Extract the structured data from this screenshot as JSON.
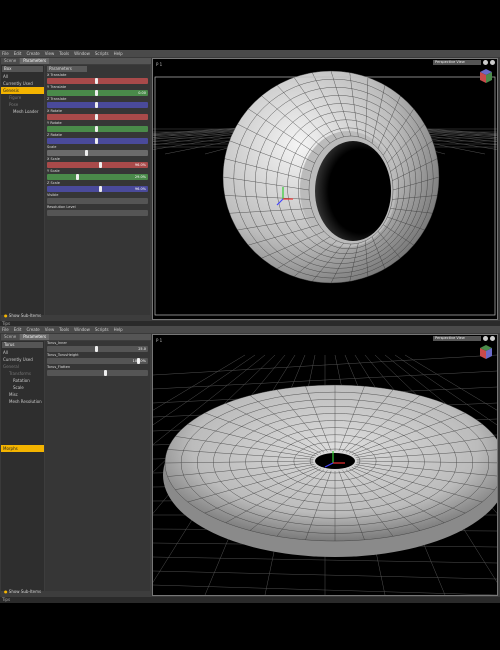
{
  "menu": [
    "File",
    "Edit",
    "Create",
    "View",
    "Tools",
    "Window",
    "Scripts",
    "Help"
  ],
  "screen1": {
    "tabs": [
      "Scene",
      "Parameters"
    ],
    "scene_dropdown": "Box",
    "tree": {
      "filters": [
        "All",
        "Currently Used"
      ],
      "items": [
        "Genesis",
        "Figure",
        "Pose",
        "Mesh Loader"
      ]
    },
    "params_dropdown": "Parameters",
    "params": [
      {
        "label": "X Translate",
        "value": "",
        "color": "#a84a4a",
        "knob": 0.5
      },
      {
        "label": "Y Translate",
        "value": "0.00",
        "color": "#4a8a4a",
        "knob": 0.5
      },
      {
        "label": "Z Translate",
        "value": "",
        "color": "#4a4a9a",
        "knob": 0.5
      },
      {
        "label": "X Rotate",
        "value": "",
        "color": "#a84a4a",
        "knob": 0.5
      },
      {
        "label": "Y Rotate",
        "value": "",
        "color": "#4a8a4a",
        "knob": 0.5
      },
      {
        "label": "Z Rotate",
        "value": "",
        "color": "#4a4a9a",
        "knob": 0.5
      },
      {
        "label": "Scale",
        "value": "",
        "color": "#6a6a6a",
        "knob": 0.4
      },
      {
        "label": "X Scale",
        "value": "96.0%",
        "color": "#a84a4a",
        "knob": 0.55
      },
      {
        "label": "Y Scale",
        "value": "29.0%",
        "color": "#4a8a4a",
        "knob": 0.3
      },
      {
        "label": "Z Scale",
        "value": "96.0%",
        "color": "#4a4a9a",
        "knob": 0.55
      },
      {
        "label": "Visible",
        "value": "",
        "color": "#555",
        "knob": 0
      },
      {
        "label": "Resolution Level",
        "value": "",
        "color": "#555",
        "knob": 0
      }
    ],
    "show_sub_items": "Show Sub-Items",
    "status": "Tips",
    "view_dropdown": "Perspective View",
    "corner": "P 1"
  },
  "screen2": {
    "tabs": [
      "Scene",
      "Parameters"
    ],
    "scene_dropdown": "Torus",
    "tree": {
      "filters": [
        "All",
        "Currently Used"
      ],
      "items": [
        "General",
        "Transforms",
        "Rotation",
        "Scale",
        "Misc",
        "Mesh Resolution",
        "Morphs"
      ]
    },
    "params_dropdown": "Parameters",
    "params": [
      {
        "label": "Torus_Inner",
        "value": "25.0",
        "color": "#555",
        "knob": 0.5
      },
      {
        "label": "Torus_TorusHeight",
        "value": "100.0%",
        "color": "#555",
        "knob": 0.95
      },
      {
        "label": "Torus_Flatten",
        "value": "",
        "color": "#555",
        "knob": 0.6
      }
    ],
    "show_sub_items": "Show Sub-Items",
    "status": "Tips",
    "view_dropdown": "Perspective View",
    "corner": "P 1"
  }
}
